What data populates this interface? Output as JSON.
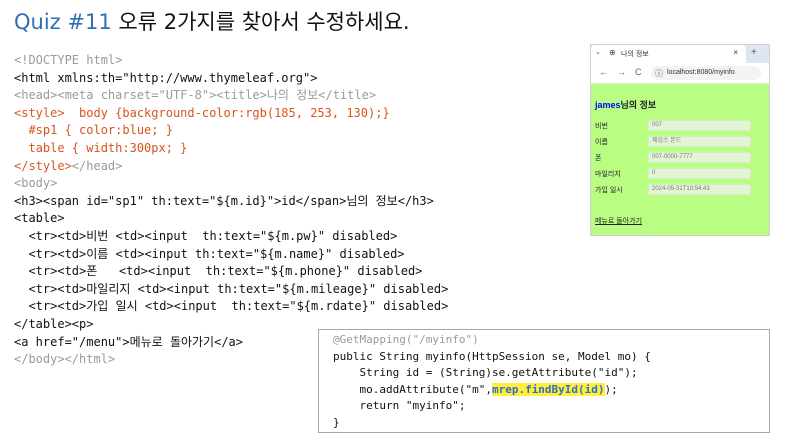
{
  "title": {
    "quiz": "Quiz #11",
    "text": "오류 2가지를 찾아서 수정하세요."
  },
  "html_code": [
    [
      {
        "t": "<!DOCTYPE html>",
        "c": "gray"
      }
    ],
    [
      {
        "t": "<html xmlns:th=\"http://www.thymeleaf.org\">",
        "c": "black"
      }
    ],
    [
      {
        "t": "<head><meta charset=\"UTF-8\"><title>나의 정보</title>",
        "c": "gray"
      }
    ],
    [
      {
        "t": "<style>  body {background-color:rgb(185, 253, 130);}",
        "c": "orange"
      }
    ],
    [
      {
        "t": "  #sp1 { color:blue; }",
        "c": "orange"
      }
    ],
    [
      {
        "t": "  table { width:300px; }",
        "c": "orange"
      }
    ],
    [
      {
        "t": "</style>",
        "c": "orange"
      },
      {
        "t": "</head>",
        "c": "gray"
      }
    ],
    [
      {
        "t": "<body>",
        "c": "gray"
      }
    ],
    [
      {
        "t": "<h3><span id=\"sp1\" th:text=\"${m.id}\">id</span>님의 정보</h3>",
        "c": "black"
      }
    ],
    [
      {
        "t": "<table>",
        "c": "black"
      }
    ],
    [
      {
        "t": "  <tr><td>비번 <td><input  th:text=\"${m.pw}\" disabled>",
        "c": "black"
      }
    ],
    [
      {
        "t": "  <tr><td>이름 <td><input th:text=\"${m.name}\" disabled>",
        "c": "black"
      }
    ],
    [
      {
        "t": "  <tr><td>폰   <td><input  th:text=\"${m.phone}\" disabled>",
        "c": "black"
      }
    ],
    [
      {
        "t": "  <tr><td>마일리지 <td><input th:text=\"${m.mileage}\" disabled>",
        "c": "black"
      }
    ],
    [
      {
        "t": "  <tr><td>가입 일시 <td><input  th:text=\"${m.rdate}\" disabled>",
        "c": "black"
      }
    ],
    [
      {
        "t": "</table><p>",
        "c": "black"
      }
    ],
    [
      {
        "t": "<a href=\"/menu\">메뉴로 돌아가기</a>",
        "c": "black"
      }
    ],
    [
      {
        "t": "</body></html>",
        "c": "gray"
      }
    ]
  ],
  "browser": {
    "tab_title": "나의 정보",
    "close_glyph": "×",
    "new_tab_glyph": "+",
    "back_glyph": "←",
    "forward_glyph": "→",
    "reload_glyph": "C",
    "url": "localhost:8080/myinfo",
    "bg_color": "#b9fd82",
    "heading_id": "james",
    "heading_rest": "님의 정보",
    "rows": [
      {
        "label": "비번",
        "value": "007"
      },
      {
        "label": "이름",
        "value": "제임스 본드"
      },
      {
        "label": "폰",
        "value": "007-0000-7777"
      },
      {
        "label": "마일리지",
        "value": "0"
      },
      {
        "label": "가입 일시",
        "value": "2024-05-31T10:54:43"
      }
    ],
    "menu_link": "메뉴로 돌아가기"
  },
  "java_code": [
    [
      {
        "t": "@GetMapping(\"/myinfo\")",
        "c": "gray"
      }
    ],
    [
      {
        "t": "public String myinfo(HttpSession se, Model mo) {",
        "c": "black"
      }
    ],
    [
      {
        "t": "    String id = (String)se.getAttribute(\"id\");",
        "c": "black"
      }
    ],
    [
      {
        "t": "    mo.addAttribute(\"m\",",
        "c": "black"
      },
      {
        "t": "mrep.findById(id)",
        "c": "hl"
      },
      {
        "t": ");",
        "c": "black"
      }
    ],
    [
      {
        "t": "    return \"myinfo\";",
        "c": "black"
      }
    ],
    [
      {
        "t": "}",
        "c": "black"
      }
    ]
  ]
}
